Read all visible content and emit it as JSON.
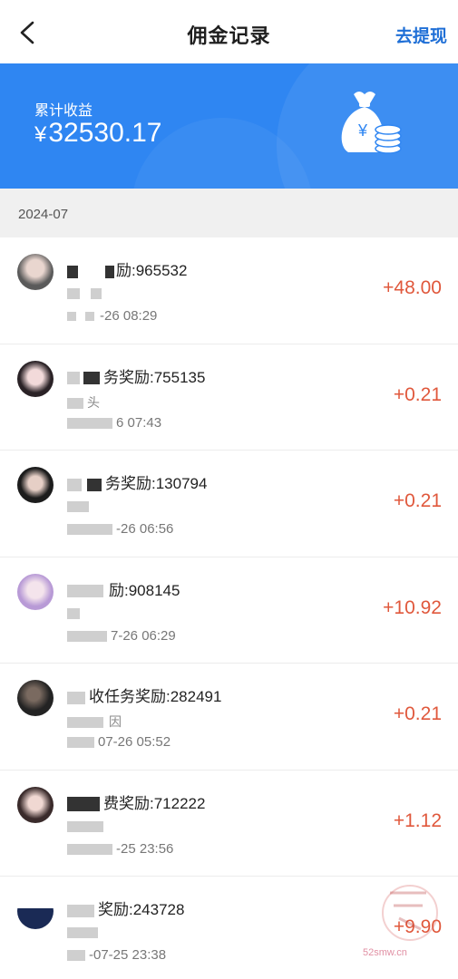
{
  "header": {
    "title": "佣金记录",
    "withdraw_label": "去提现"
  },
  "summary": {
    "label": "累计收益",
    "currency": "¥",
    "amount": "32530.17"
  },
  "date_group": "2024-07",
  "records": [
    {
      "name": "励:965532",
      "sub": "",
      "time": "-26 08:29",
      "amount": "+48.00"
    },
    {
      "name": "务奖励:755135",
      "sub": "头",
      "time": "6 07:43",
      "amount": "+0.21"
    },
    {
      "name": "务奖励:130794",
      "sub": "",
      "time": "-26 06:56",
      "amount": "+0.21"
    },
    {
      "name": "励:908145",
      "sub": "",
      "time": "7-26 06:29",
      "amount": "+10.92"
    },
    {
      "name": "收任务奖励:282491",
      "sub": "因",
      "time": "07-26 05:52",
      "amount": "+0.21"
    },
    {
      "name": "费奖励:712222",
      "sub": "",
      "time": "-25 23:56",
      "amount": "+1.12"
    },
    {
      "name": "奖励:243728",
      "sub": "",
      "time": "-07-25 23:38",
      "amount": "+9.90"
    }
  ],
  "colors": {
    "banner": "#2f86f2",
    "accent_link": "#1f6fd6",
    "amount": "#e0583c"
  },
  "watermark": "52smw.cn"
}
